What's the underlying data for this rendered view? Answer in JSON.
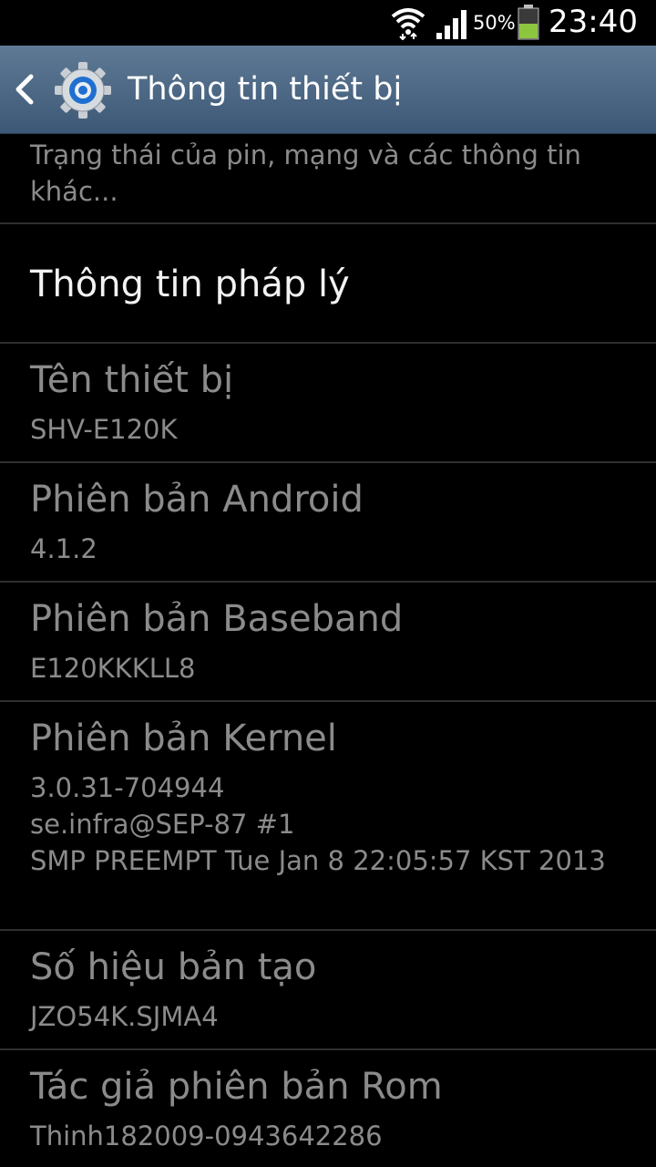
{
  "status_bar": {
    "battery_percent": "50%",
    "battery_level": 0.5,
    "time": "23:40",
    "icons": [
      "wifi-icon",
      "signal-icon",
      "battery-icon"
    ],
    "battery_color": "#8cc63f"
  },
  "action_bar": {
    "title": "Thông tin thiết bị",
    "icons": [
      "back-icon",
      "settings-gear-icon"
    ],
    "background": "#4b6683"
  },
  "list": {
    "status_summary": "Trạng thái của pin, mạng và các thông tin khác...",
    "items": [
      {
        "title": "Thông tin pháp lý"
      },
      {
        "title": "Tên thiết bị",
        "value": "SHV-E120K"
      },
      {
        "title": "Phiên bản Android",
        "value": "4.1.2"
      },
      {
        "title": "Phiên bản Baseband",
        "value": "E120KKKLL8"
      },
      {
        "title": "Phiên bản Kernel",
        "value": "3.0.31-704944\nse.infra@SEP-87 #1\nSMP PREEMPT Tue Jan 8 22:05:57 KST 2013"
      },
      {
        "title": "Số hiệu bản tạo",
        "value": "JZO54K.SJMA4"
      },
      {
        "title": "Tác giả phiên bản Rom",
        "value": "Thinh182009-0943642286"
      }
    ]
  }
}
